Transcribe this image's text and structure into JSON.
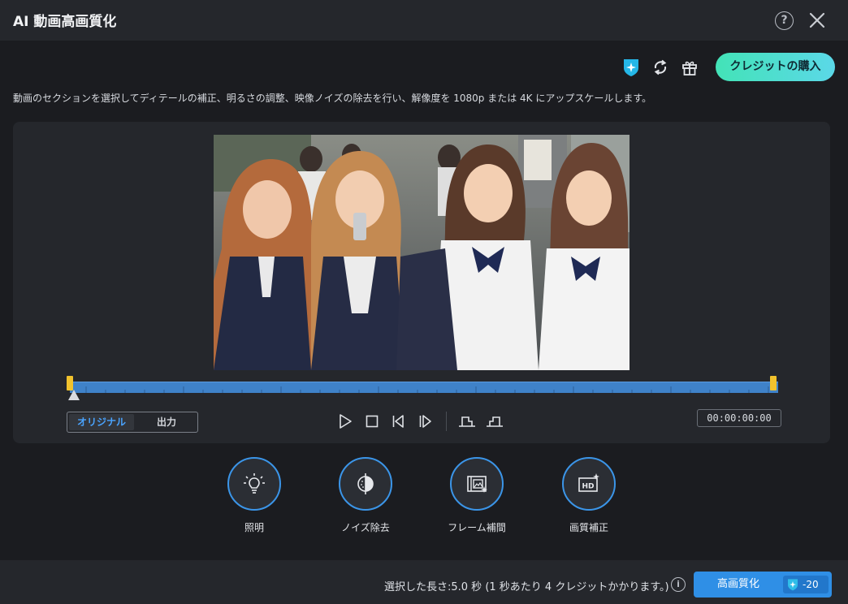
{
  "window": {
    "title": "AI 動画高画質化"
  },
  "toolbar": {
    "buy_label": "クレジットの購入"
  },
  "description": "動画のセクションを選択してディテールの補正、明るさの調整、映像ノイズの除去を行い、解像度を 1080p または 4K にアップスケールします。",
  "preview": {
    "compare": {
      "original_label": "オリジナル",
      "output_label": "出力",
      "selected": "オリジナル"
    },
    "timecode": "00:00:00:00"
  },
  "features": [
    {
      "label": "照明",
      "icon": "lightbulb-icon"
    },
    {
      "label": "ノイズ除去",
      "icon": "denoise-icon"
    },
    {
      "label": "フレーム補間",
      "icon": "frame-interpolation-icon"
    },
    {
      "label": "画質補正",
      "icon": "hd-icon"
    }
  ],
  "footer": {
    "info_text": "選択した長さ:5.0 秒 (1 秒あたり 4 クレジットかかります。)",
    "enhance_label": "高画質化",
    "credit_cost": "-20"
  },
  "colors": {
    "accent": "#3b95e8",
    "buy_button": "#43e3b7",
    "handle": "#f1c22d",
    "timeline": "#3f82c9"
  }
}
